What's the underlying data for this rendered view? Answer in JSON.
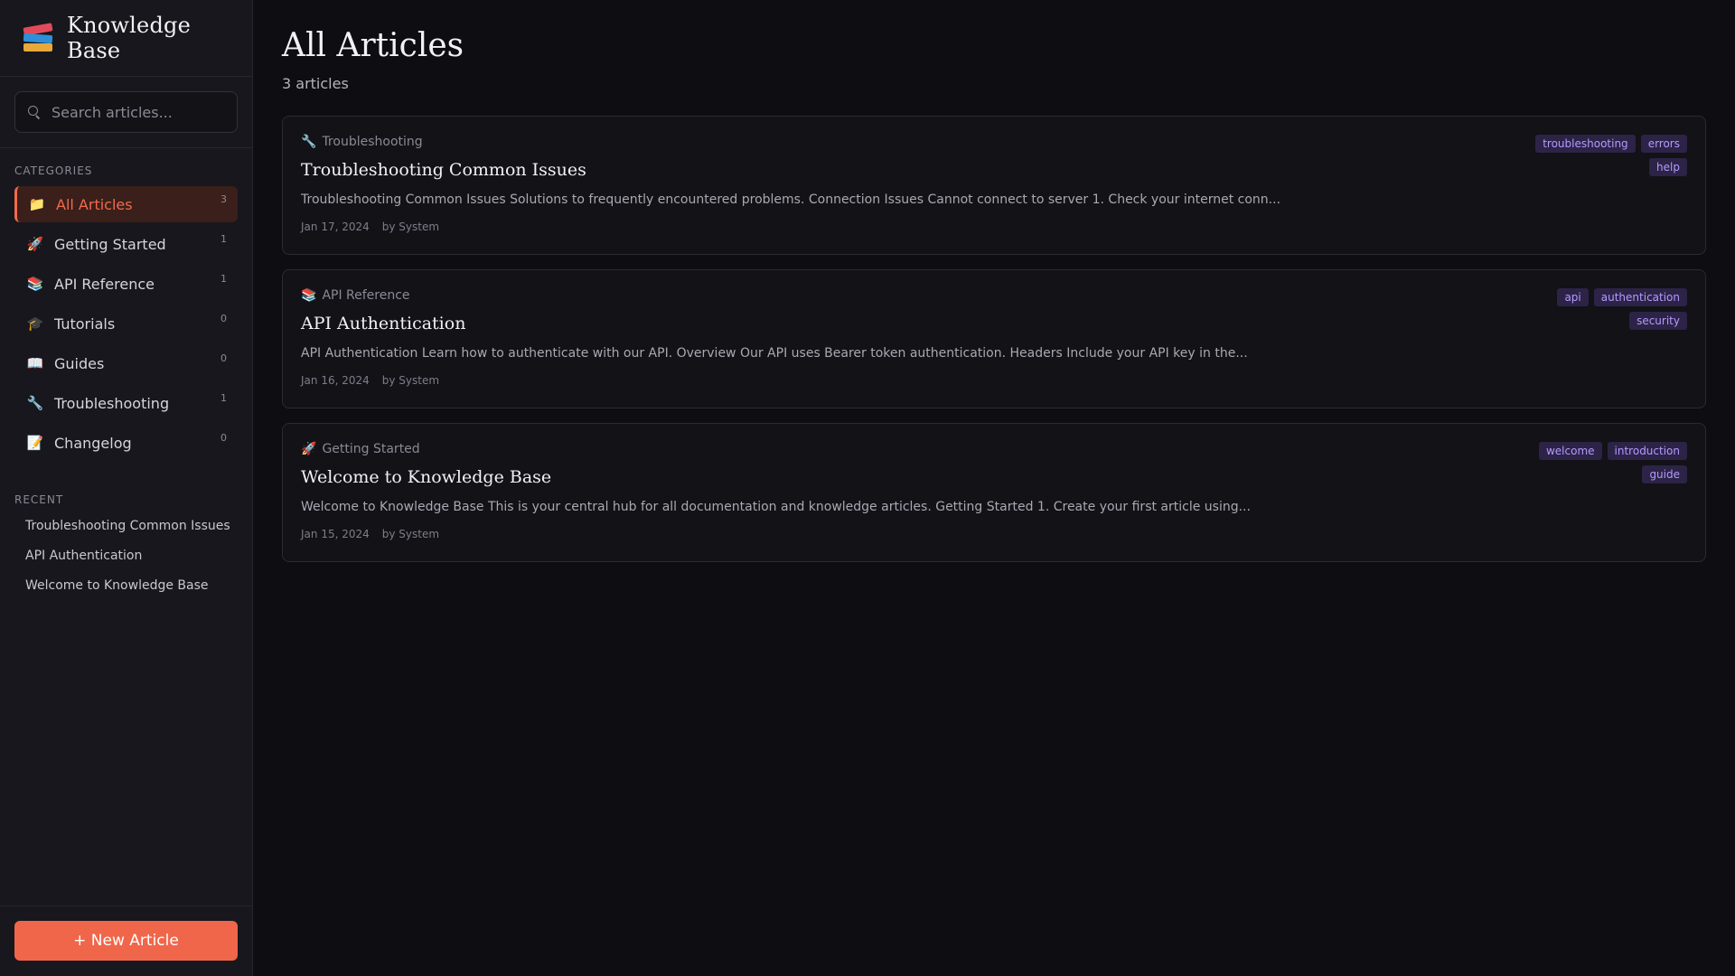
{
  "brand": {
    "title": "Knowledge Base",
    "icon": "books-icon"
  },
  "search": {
    "placeholder": "Search articles..."
  },
  "sidebar": {
    "categories_label": "CATEGORIES",
    "categories": [
      {
        "emoji": "📁",
        "label": "All Articles",
        "count": "3",
        "active": true
      },
      {
        "emoji": "🚀",
        "label": "Getting Started",
        "count": "1"
      },
      {
        "emoji": "📚",
        "label": "API Reference",
        "count": "1"
      },
      {
        "emoji": "🎓",
        "label": "Tutorials",
        "count": "0"
      },
      {
        "emoji": "📖",
        "label": "Guides",
        "count": "0"
      },
      {
        "emoji": "🔧",
        "label": "Troubleshooting",
        "count": "1"
      },
      {
        "emoji": "📝",
        "label": "Changelog",
        "count": "0"
      }
    ],
    "recent_label": "RECENT",
    "recent": [
      "Troubleshooting Common Issues",
      "API Authentication",
      "Welcome to Knowledge Base"
    ],
    "new_article_label": "+ New Article"
  },
  "main": {
    "title": "All Articles",
    "count_text": "3 articles",
    "articles": [
      {
        "category_emoji": "🔧",
        "category": "Troubleshooting",
        "title": "Troubleshooting Common Issues",
        "excerpt": "Troubleshooting Common Issues Solutions to frequently encountered problems. Connection Issues Cannot connect to server 1. Check your internet conn...",
        "date": "Jan 17, 2024",
        "author": "by System",
        "tags": [
          "troubleshooting",
          "errors",
          "help"
        ]
      },
      {
        "category_emoji": "📚",
        "category": "API Reference",
        "title": "API Authentication",
        "excerpt": "API Authentication Learn how to authenticate with our API. Overview Our API uses Bearer token authentication. Headers Include your API key in the...",
        "date": "Jan 16, 2024",
        "author": "by System",
        "tags": [
          "api",
          "authentication",
          "security"
        ]
      },
      {
        "category_emoji": "🚀",
        "category": "Getting Started",
        "title": "Welcome to Knowledge Base",
        "excerpt": "Welcome to Knowledge Base This is your central hub for all documentation and knowledge articles. Getting Started 1. Create your first article using...",
        "date": "Jan 15, 2024",
        "author": "by System",
        "tags": [
          "welcome",
          "introduction",
          "guide"
        ]
      }
    ]
  },
  "colors": {
    "accent": "#f0664a",
    "tag_text": "#b59aff",
    "tag_bg": "#2c2347",
    "background": "#0e0e12",
    "sidebar_bg": "#17171d"
  }
}
